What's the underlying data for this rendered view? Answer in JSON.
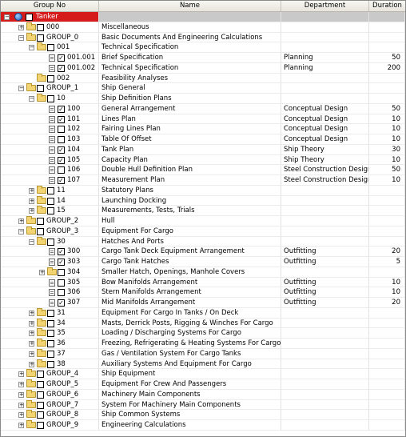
{
  "columns": {
    "group": "Group No",
    "name": "Name",
    "department": "Department",
    "duration": "Duration"
  },
  "root": {
    "code": "Tanker"
  },
  "rows": [
    {
      "code": "000",
      "name": "Miscellaneous",
      "department": "",
      "duration": ""
    },
    {
      "code": "GROUP_0",
      "name": "Basic Documents And Engineering Calculations",
      "department": "",
      "duration": ""
    },
    {
      "code": "001",
      "name": "Technical Specification",
      "department": "",
      "duration": ""
    },
    {
      "code": "001.001",
      "name": "Brief Specification",
      "department": "Planning",
      "duration": "50"
    },
    {
      "code": "001.002",
      "name": "Technical Specification",
      "department": "Planning",
      "duration": "200"
    },
    {
      "code": "002",
      "name": "Feasibility Analyses",
      "department": "",
      "duration": ""
    },
    {
      "code": "GROUP_1",
      "name": "Ship General",
      "department": "",
      "duration": ""
    },
    {
      "code": "10",
      "name": "Ship Definition Plans",
      "department": "",
      "duration": ""
    },
    {
      "code": "100",
      "name": "General Arrangement",
      "department": "Conceptual Design",
      "duration": "50"
    },
    {
      "code": "101",
      "name": "Lines Plan",
      "department": "Conceptual Design",
      "duration": "10"
    },
    {
      "code": "102",
      "name": "Fairing Lines Plan",
      "department": "Conceptual Design",
      "duration": "10"
    },
    {
      "code": "103",
      "name": "Table Of Offset",
      "department": "Conceptual Design",
      "duration": "10"
    },
    {
      "code": "104",
      "name": "Tank Plan",
      "department": "Ship Theory",
      "duration": "30"
    },
    {
      "code": "105",
      "name": "Capacity Plan",
      "department": "Ship Theory",
      "duration": "10"
    },
    {
      "code": "106",
      "name": "Double Hull Definition Plan",
      "department": "Steel Construction Design",
      "duration": "50"
    },
    {
      "code": "107",
      "name": "Measurement Plan",
      "department": "Steel Construction Design",
      "duration": "10"
    },
    {
      "code": "11",
      "name": "Statutory Plans",
      "department": "",
      "duration": ""
    },
    {
      "code": "14",
      "name": "Launching Docking",
      "department": "",
      "duration": ""
    },
    {
      "code": "15",
      "name": "Measurements, Tests, Trials",
      "department": "",
      "duration": ""
    },
    {
      "code": "GROUP_2",
      "name": "Hull",
      "department": "",
      "duration": ""
    },
    {
      "code": "GROUP_3",
      "name": "Equipment For Cargo",
      "department": "",
      "duration": ""
    },
    {
      "code": "30",
      "name": "Hatches And Ports",
      "department": "",
      "duration": ""
    },
    {
      "code": "300",
      "name": "Cargo Tank Deck Equipment Arrangement",
      "department": "Outfitting",
      "duration": "20"
    },
    {
      "code": "303",
      "name": "Cargo Tank Hatches",
      "department": "Outfitting",
      "duration": "5"
    },
    {
      "code": "304",
      "name": "Smaller Hatch, Openings, Manhole Covers",
      "department": "",
      "duration": ""
    },
    {
      "code": "305",
      "name": "Bow Manifolds Arrangement",
      "department": "Outfitting",
      "duration": "10"
    },
    {
      "code": "306",
      "name": "Stern Manifolds Arrangement",
      "department": "Outfitting",
      "duration": "10"
    },
    {
      "code": "307",
      "name": "Mid Manifolds Arrangement",
      "department": "Outfitting",
      "duration": "20"
    },
    {
      "code": "31",
      "name": "Equipment For Cargo In Tanks / On Deck",
      "department": "",
      "duration": ""
    },
    {
      "code": "34",
      "name": "Masts, Derrick Posts, Rigging & Winches For Cargo",
      "department": "",
      "duration": ""
    },
    {
      "code": "35",
      "name": "Loading / Discharging Systems For Cargo",
      "department": "",
      "duration": ""
    },
    {
      "code": "36",
      "name": "Freezing, Refrigerating & Heating Systems For Cargo",
      "department": "",
      "duration": ""
    },
    {
      "code": "37",
      "name": "Gas / Ventilation System For Cargo Tanks",
      "department": "",
      "duration": ""
    },
    {
      "code": "38",
      "name": "Auxiliary Systems And Equipment For Cargo",
      "department": "",
      "duration": ""
    },
    {
      "code": "GROUP_4",
      "name": "Ship Equipment",
      "department": "",
      "duration": ""
    },
    {
      "code": "GROUP_5",
      "name": "Equipment For Crew And Passengers",
      "department": "",
      "duration": ""
    },
    {
      "code": "GROUP_6",
      "name": "Machinery Main Components",
      "department": "",
      "duration": ""
    },
    {
      "code": "GROUP_7",
      "name": "System For Machinery Main Components",
      "department": "",
      "duration": ""
    },
    {
      "code": "GROUP_8",
      "name": "Ship Common Systems",
      "department": "",
      "duration": ""
    },
    {
      "code": "GROUP_9",
      "name": "Engineering Calculations",
      "department": "",
      "duration": ""
    }
  ]
}
